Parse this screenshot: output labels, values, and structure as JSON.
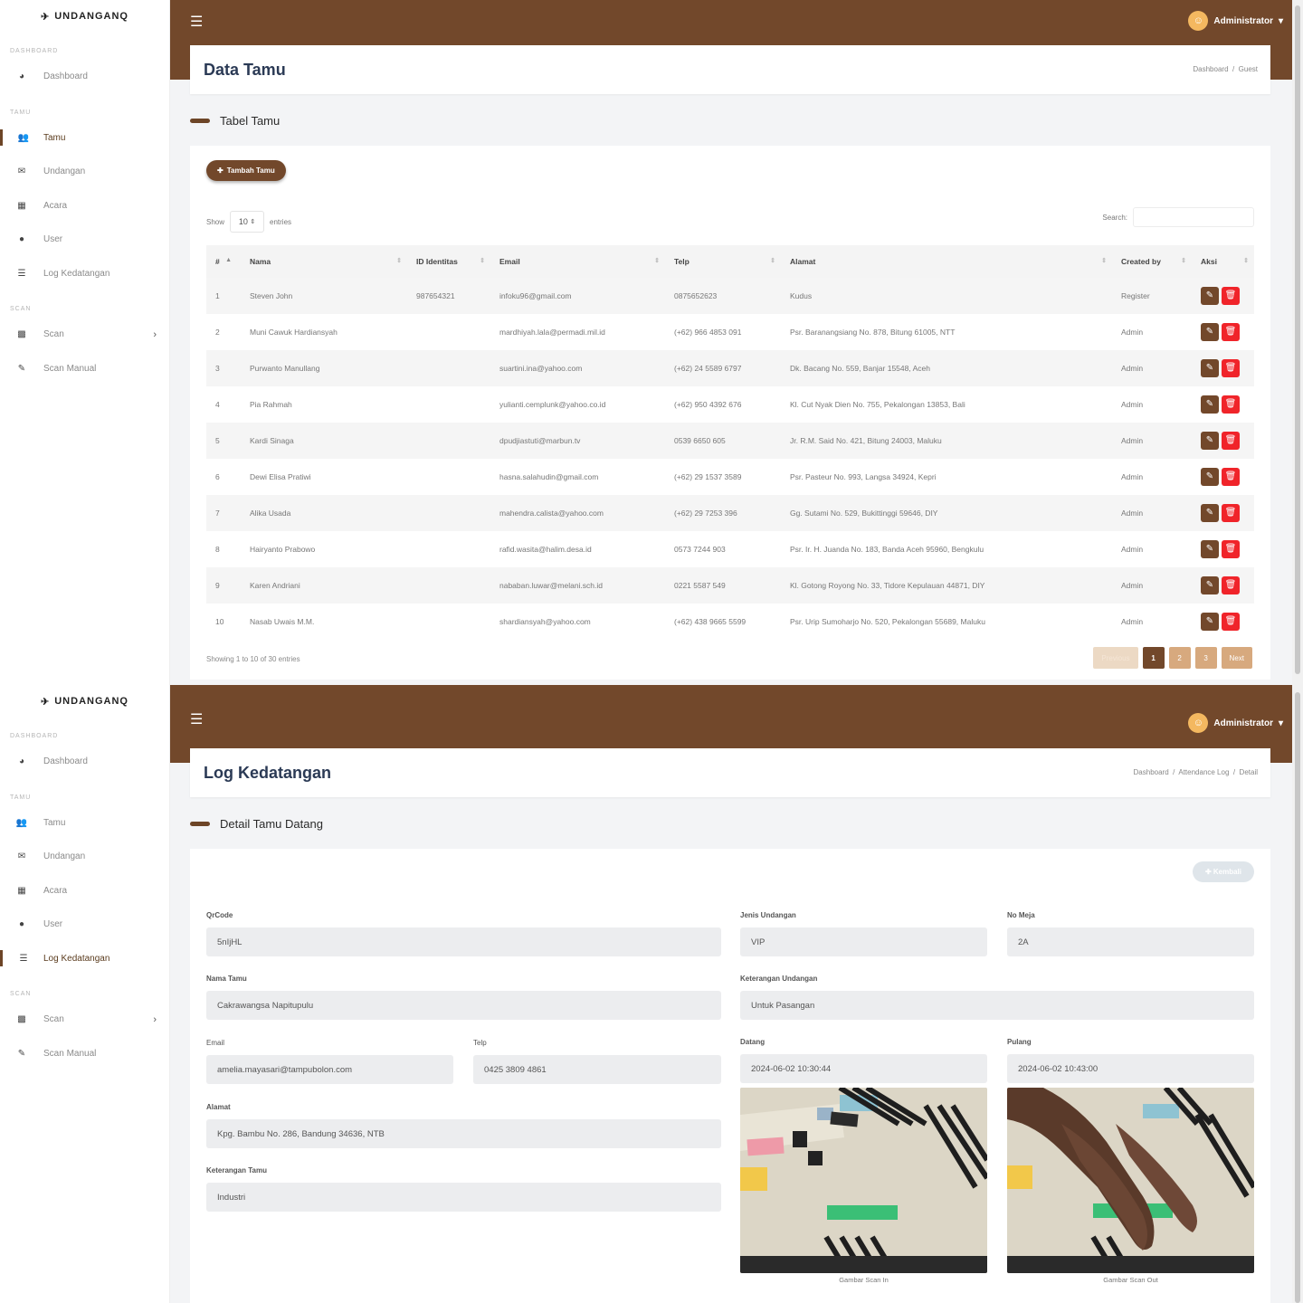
{
  "brand": "UNDANGANQ",
  "sidebar": {
    "sections": [
      "DASHBOARD",
      "TAMU",
      "SCAN"
    ],
    "items": {
      "dashboard": "Dashboard",
      "tamu": "Tamu",
      "undangan": "Undangan",
      "acara": "Acara",
      "user": "User",
      "log": "Log Kedatangan",
      "scan": "Scan",
      "scan_manual": "Scan Manual"
    }
  },
  "user": {
    "name": "Administrator"
  },
  "screen1": {
    "title": "Data Tamu",
    "breadcrumb": {
      "home": "Dashboard",
      "sep": "/",
      "current": "Guest"
    },
    "section_title": "Tabel Tamu",
    "add_button": "Tambah Tamu",
    "show_label": "Show",
    "entries_value": "10",
    "entries_label": "entries",
    "search_label": "Search:",
    "columns": [
      "#",
      "Nama",
      "ID Identitas",
      "Email",
      "Telp",
      "Alamat",
      "Created by",
      "Aksi"
    ],
    "rows": [
      {
        "no": "1",
        "nama": "Steven John",
        "id": "987654321",
        "email": "infoku96@gmail.com",
        "telp": "0875652623",
        "alamat": "Kudus",
        "by": "Register"
      },
      {
        "no": "2",
        "nama": "Muni Cawuk Hardiansyah",
        "id": "",
        "email": "mardhiyah.lala@permadi.mil.id",
        "telp": "(+62) 966 4853 091",
        "alamat": "Psr. Baranangsiang No. 878, Bitung 61005, NTT",
        "by": "Admin"
      },
      {
        "no": "3",
        "nama": "Purwanto Manullang",
        "id": "",
        "email": "suartini.ina@yahoo.com",
        "telp": "(+62) 24 5589 6797",
        "alamat": "Dk. Bacang No. 559, Banjar 15548, Aceh",
        "by": "Admin"
      },
      {
        "no": "4",
        "nama": "Pia Rahmah",
        "id": "",
        "email": "yulianti.cemplunk@yahoo.co.id",
        "telp": "(+62) 950 4392 676",
        "alamat": "Kl. Cut Nyak Dien No. 755, Pekalongan 13853, Bali",
        "by": "Admin"
      },
      {
        "no": "5",
        "nama": "Kardi Sinaga",
        "id": "",
        "email": "dpudjiastuti@marbun.tv",
        "telp": "0539 6650 605",
        "alamat": "Jr. R.M. Said No. 421, Bitung 24003, Maluku",
        "by": "Admin"
      },
      {
        "no": "6",
        "nama": "Dewi Elisa Pratiwi",
        "id": "",
        "email": "hasna.salahudin@gmail.com",
        "telp": "(+62) 29 1537 3589",
        "alamat": "Psr. Pasteur No. 993, Langsa 34924, Kepri",
        "by": "Admin"
      },
      {
        "no": "7",
        "nama": "Alika Usada",
        "id": "",
        "email": "mahendra.calista@yahoo.com",
        "telp": "(+62) 29 7253 396",
        "alamat": "Gg. Sutami No. 529, Bukittinggi 59646, DIY",
        "by": "Admin"
      },
      {
        "no": "8",
        "nama": "Hairyanto Prabowo",
        "id": "",
        "email": "rafid.wasita@halim.desa.id",
        "telp": "0573 7244 903",
        "alamat": "Psr. Ir. H. Juanda No. 183, Banda Aceh 95960, Bengkulu",
        "by": "Admin"
      },
      {
        "no": "9",
        "nama": "Karen Andriani",
        "id": "",
        "email": "nababan.luwar@melani.sch.id",
        "telp": "0221 5587 549",
        "alamat": "Kl. Gotong Royong No. 33, Tidore Kepulauan 44871, DIY",
        "by": "Admin"
      },
      {
        "no": "10",
        "nama": "Nasab Uwais M.M.",
        "id": "",
        "email": "shardiansyah@yahoo.com",
        "telp": "(+62) 438 9665 5599",
        "alamat": "Psr. Urip Sumoharjo No. 520, Pekalongan 55689, Maluku",
        "by": "Admin"
      }
    ],
    "footer": "Showing 1 to 10 of 30 entries",
    "pagination": {
      "prev": "Previous",
      "pages": [
        "1",
        "2",
        "3"
      ],
      "next": "Next"
    }
  },
  "screen2": {
    "title": "Log Kedatangan",
    "breadcrumb": {
      "home": "Dashboard",
      "mid": "Attendance Log",
      "sep": "/",
      "current": "Detail"
    },
    "section_title": "Detail Tamu Datang",
    "back_button": "Kembali",
    "fields": {
      "qrcode": {
        "label": "QrCode",
        "value": "5nIjHL"
      },
      "jenis": {
        "label": "Jenis Undangan",
        "value": "VIP"
      },
      "meja": {
        "label": "No Meja",
        "value": "2A"
      },
      "nama": {
        "label": "Nama Tamu",
        "value": "Cakrawangsa Napitupulu"
      },
      "ket_undangan": {
        "label": "Keterangan Undangan",
        "value": "Untuk Pasangan"
      },
      "email": {
        "label": "Email",
        "value": "amelia.mayasari@tampubolon.com"
      },
      "telp": {
        "label": "Telp",
        "value": "0425 3809 4861"
      },
      "datang": {
        "label": "Datang",
        "value": "2024-06-02 10:30:44"
      },
      "pulang": {
        "label": "Pulang",
        "value": "2024-06-02 10:43:00"
      },
      "alamat": {
        "label": "Alamat",
        "value": "Kpg. Bambu No. 286, Bandung 34636, NTB"
      },
      "ket_tamu": {
        "label": "Keterangan Tamu",
        "value": "Industri"
      }
    },
    "captions": {
      "in": "Gambar Scan In",
      "out": "Gambar Scan Out"
    }
  }
}
